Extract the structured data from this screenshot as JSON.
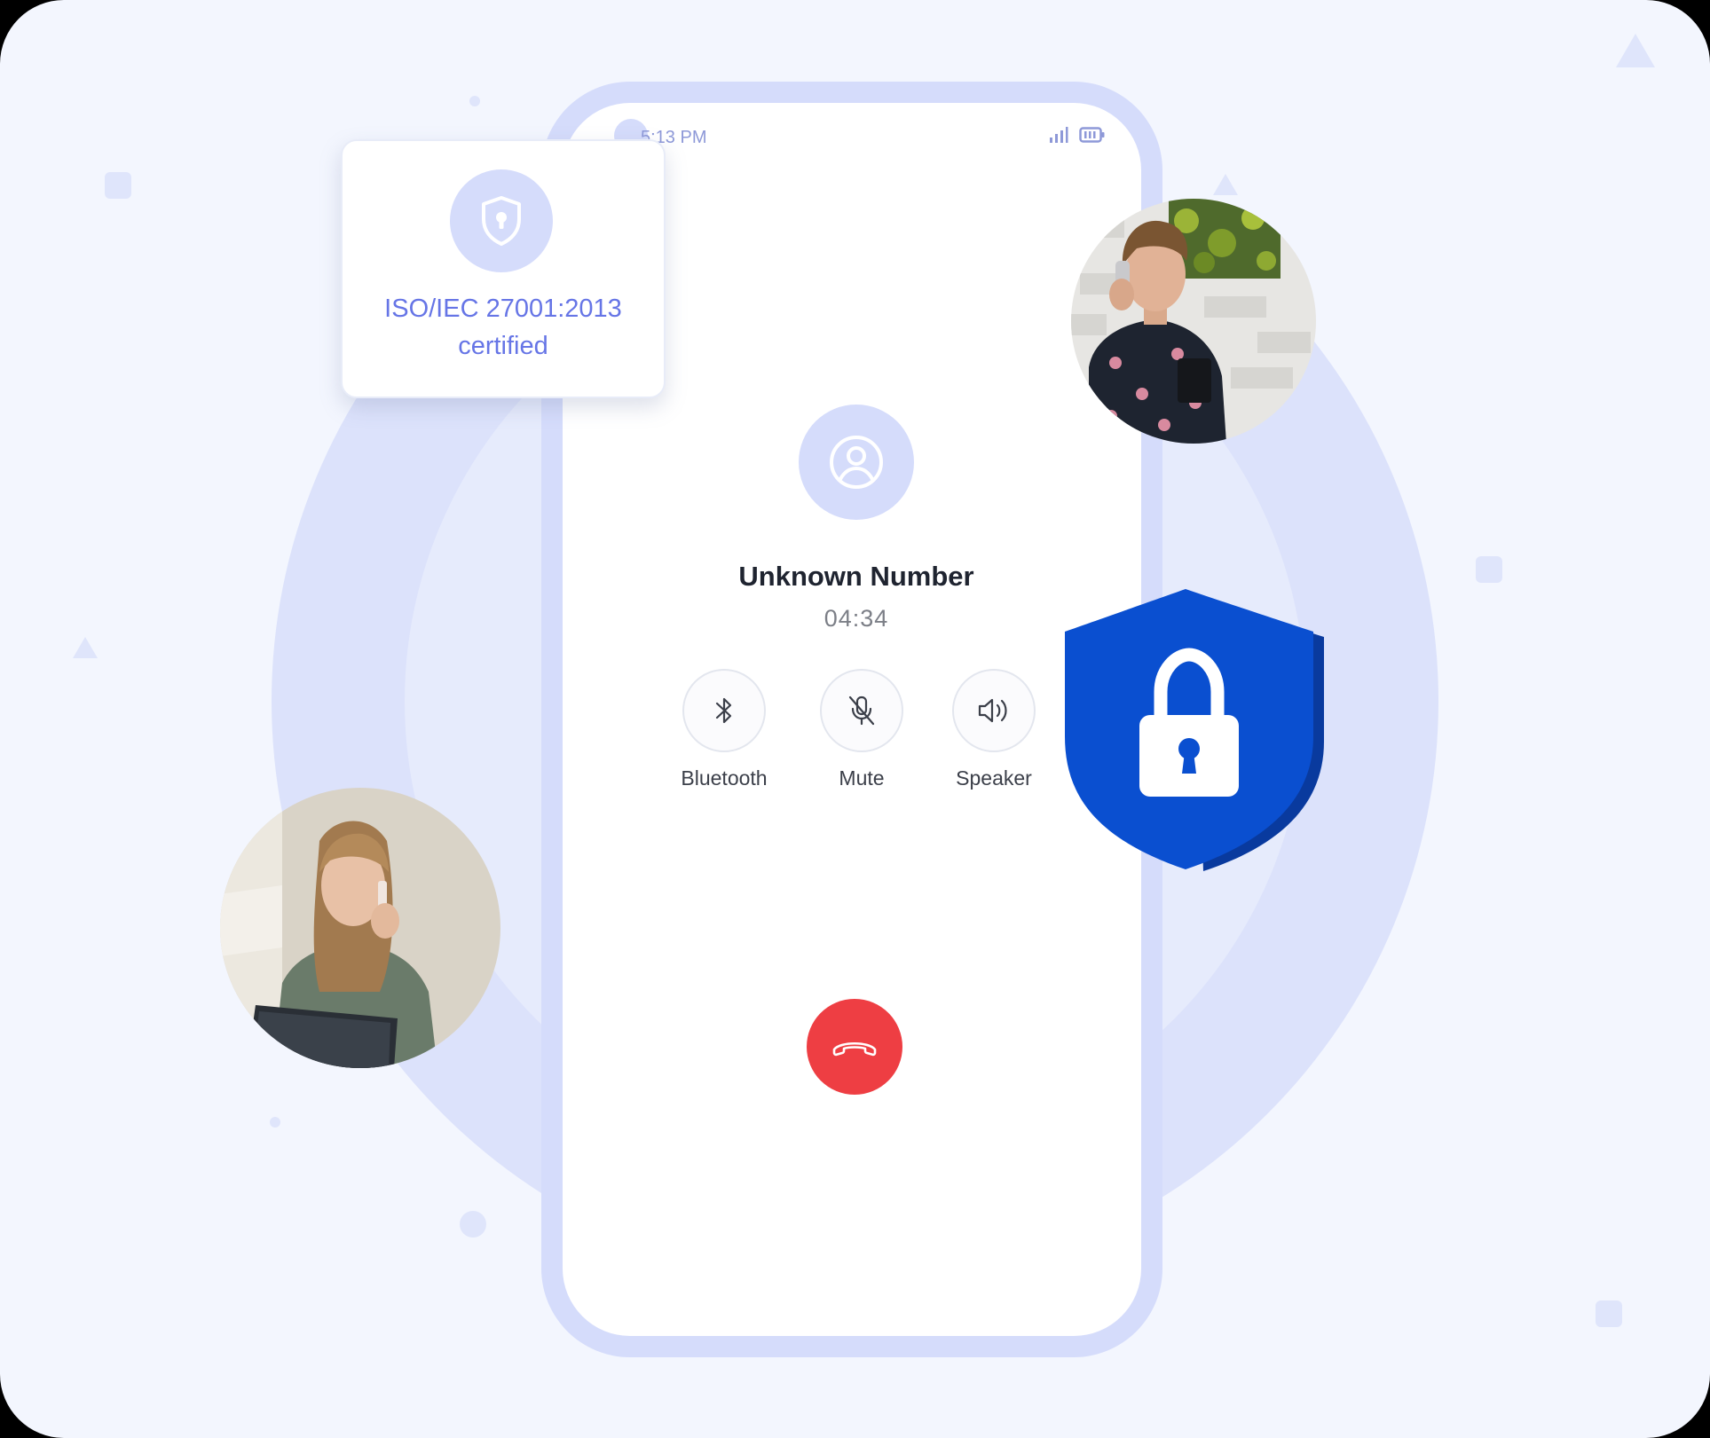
{
  "status_bar": {
    "time": "5:13 PM",
    "signal_icon": "signal-bars-icon",
    "battery_icon": "battery-icon"
  },
  "certification": {
    "icon": "shield-keyhole-icon",
    "line1": "ISO/IEC 27001:2013",
    "line2": "certified"
  },
  "call": {
    "caller_icon": "user-circle-icon",
    "caller_name": "Unknown Number",
    "duration": "04:34"
  },
  "controls": [
    {
      "label": "Bluetooth",
      "icon": "bluetooth-icon"
    },
    {
      "label": "Mute",
      "icon": "mic-off-icon"
    },
    {
      "label": "Speaker",
      "icon": "speaker-icon"
    }
  ],
  "end_call": {
    "icon": "phone-hangup-icon"
  },
  "colors": {
    "background": "#f3f6fe",
    "ring": "#dce2fb",
    "phone_frame": "#d5dcfb",
    "accent_text": "#6675e6",
    "end_call": "#ee3e43",
    "security_shield": "#0a4fd0"
  }
}
